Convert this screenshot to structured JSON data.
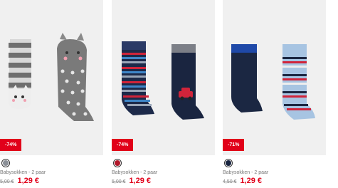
{
  "products": [
    {
      "discount": "-74%",
      "name": "Babysokken - 2 paar",
      "old_price": "5,00 €",
      "new_price": "1,29 €",
      "swatch_color": "#8a8f96",
      "image": "grey-cat-socks"
    },
    {
      "discount": "-74%",
      "name": "Babysokken - 2 paar",
      "old_price": "5,00 €",
      "new_price": "1,29 €",
      "swatch_color": "#b2182b",
      "image": "navy-striped-car-socks"
    },
    {
      "discount": "-71%",
      "name": "Babysokken - 2 paar",
      "old_price": "4,50 €",
      "new_price": "1,29 €",
      "swatch_color": "#17233f",
      "image": "navy-blue-striped-socks"
    }
  ],
  "colors": {
    "badge": "#e1001a",
    "price": "#e1001a",
    "image_bg": "#f0f0f0"
  }
}
